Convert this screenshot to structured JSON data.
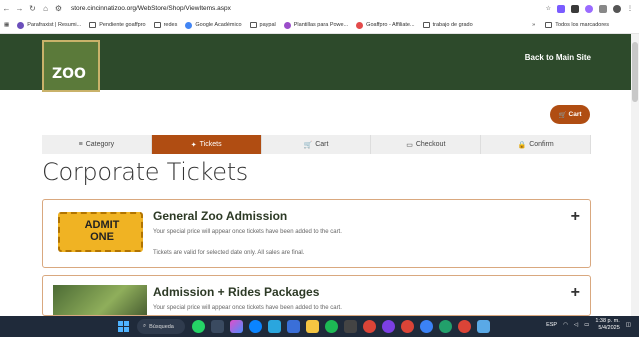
{
  "browser": {
    "url": "store.cincinnatizoo.org/WebStore/Shop/ViewItems.aspx",
    "bookmarks": [
      "Parafraxist | Resumi...",
      "Pendiente goaffpro",
      "redes",
      "Google Académico",
      "paypal",
      "Plantillas para Powe...",
      "Goaffpro - Affiliate...",
      "trabajo de grado"
    ],
    "bookmarks_right": "Todos los marcadores",
    "overflow_icon": "»"
  },
  "header": {
    "logo_text": "ZOO",
    "back_link": "Back to Main Site"
  },
  "cart_button": {
    "label": "Cart",
    "icon": "cart-icon"
  },
  "steps": [
    {
      "label": "Category",
      "icon": "list-icon",
      "active": false
    },
    {
      "label": "Tickets",
      "icon": "ticket-icon",
      "active": true
    },
    {
      "label": "Cart",
      "icon": "cart-icon",
      "active": false
    },
    {
      "label": "Checkout",
      "icon": "card-icon",
      "active": false
    },
    {
      "label": "Confirm",
      "icon": "lock-icon",
      "active": false
    }
  ],
  "page_title": "Corporate Tickets",
  "products": [
    {
      "title": "General Zoo Admission",
      "image_text": [
        "ADMIT",
        "ONE"
      ],
      "line1": "Your special price will appear once tickets have been added to the cart.",
      "line2": "Tickets are valid for selected date only. All sales are final.",
      "expand_icon": "+"
    },
    {
      "title": "Admission + Rides Packages",
      "line1": "Your special price will appear once tickets have been added to the cart.",
      "expand_icon": "+"
    }
  ],
  "taskbar": {
    "search_label": "Búsqueda",
    "language": "ESP",
    "time": "1:38 p. m.",
    "date": "5/4/2025"
  },
  "colors": {
    "header_green": "#2d4a2b",
    "accent_orange": "#b04d12",
    "card_border": "#d9a87f"
  }
}
